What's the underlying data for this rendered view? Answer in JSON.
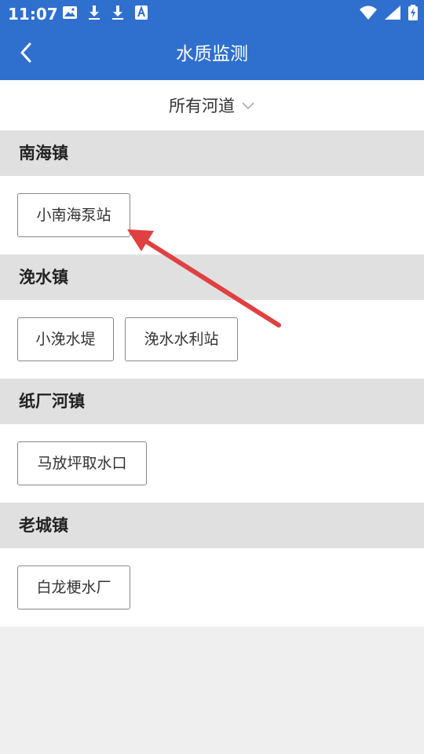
{
  "status_bar": {
    "time": "11:07",
    "left_icons": [
      "image-icon",
      "download-icon",
      "download-icon",
      "text-icon"
    ],
    "right_icons": [
      "wifi-icon",
      "signal-icon",
      "battery-charging-icon"
    ]
  },
  "app_bar": {
    "back_icon": "chevron-left-icon",
    "title": "水质监测"
  },
  "filter": {
    "label": "所有河道",
    "icon": "chevron-down-icon"
  },
  "sections": [
    {
      "title": "南海镇",
      "stations": [
        "小南海泵站"
      ]
    },
    {
      "title": "浼水镇",
      "stations": [
        "小浼水堤",
        "浼水水利站"
      ]
    },
    {
      "title": "纸厂河镇",
      "stations": [
        "马放坪取水口"
      ]
    },
    {
      "title": "老城镇",
      "stations": [
        "白龙梗水厂"
      ]
    }
  ],
  "annotation": {
    "type": "arrow",
    "color": "#e04040"
  },
  "colors": {
    "header_blue": "#2f6fce",
    "section_header_bg": "#e0e0e0",
    "page_bg": "#efefef",
    "chip_border": "#888888"
  }
}
